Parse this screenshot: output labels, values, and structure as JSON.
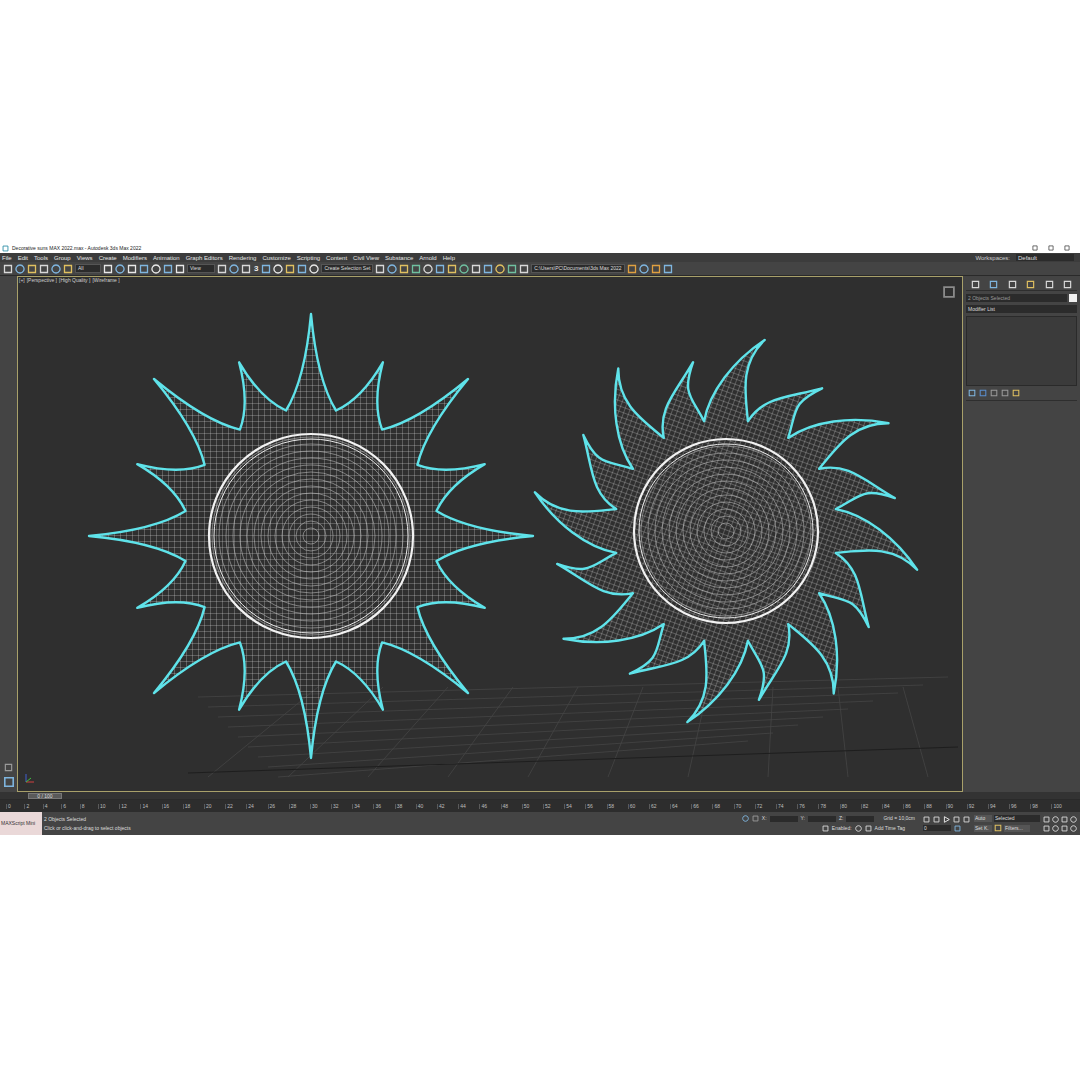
{
  "window": {
    "title": "Decorative suns MAX 2022.max - Autodesk 3ds Max 2022"
  },
  "menu": [
    "File",
    "Edit",
    "Tools",
    "Group",
    "Views",
    "Create",
    "Modifiers",
    "Animation",
    "Graph Editors",
    "Rendering",
    "Customize",
    "Scripting",
    "Content",
    "Civil View",
    "Substance",
    "Arnold",
    "Help"
  ],
  "workspace": {
    "label": "Workspaces:",
    "value": "Default"
  },
  "toolbar": {
    "selection_filter": "All",
    "reference_coord": "View",
    "snap": "3",
    "named_selection": "Create Selection Set",
    "project_path": "C:\\Users\\PC\\Documents\\3ds Max 2022"
  },
  "viewport": {
    "labels": [
      "[+]",
      "[Perspective ]",
      "[High Quality ]",
      "[Wireframe ]"
    ]
  },
  "objects": [
    {
      "kind": "spiky",
      "selected": true
    },
    {
      "kind": "wavy",
      "selected": true
    }
  ],
  "command_panel": {
    "selection": "2 Objects Selected",
    "modifier_list": "Modifier List"
  },
  "timeline": {
    "frame": "0 / 100",
    "level": 0,
    "ticks": [
      "0",
      "2",
      "4",
      "6",
      "8",
      "10",
      "12",
      "14",
      "16",
      "18",
      "20",
      "22",
      "24",
      "26",
      "28",
      "30",
      "32",
      "34",
      "36",
      "38",
      "40",
      "42",
      "44",
      "46",
      "48",
      "50",
      "52",
      "54",
      "56",
      "58",
      "60",
      "62",
      "64",
      "66",
      "68",
      "70",
      "72",
      "74",
      "76",
      "78",
      "80",
      "82",
      "84",
      "86",
      "88",
      "90",
      "92",
      "94",
      "96",
      "98",
      "100"
    ]
  },
  "status": {
    "maxscript": "MAXScript Mini",
    "selection": "2 Objects Selected",
    "prompt": "Click or click-and-drag to select objects",
    "axes": [
      "X:",
      "Y:",
      "Z:"
    ],
    "grid": "Grid = 10,0cm",
    "enabled": "Enabled:",
    "add_time_tag": "Add Time Tag",
    "auto": "Auto",
    "key_filter": "Selected",
    "set_key": "Set K.",
    "filters": "Filters...",
    "frame_field": "0"
  }
}
